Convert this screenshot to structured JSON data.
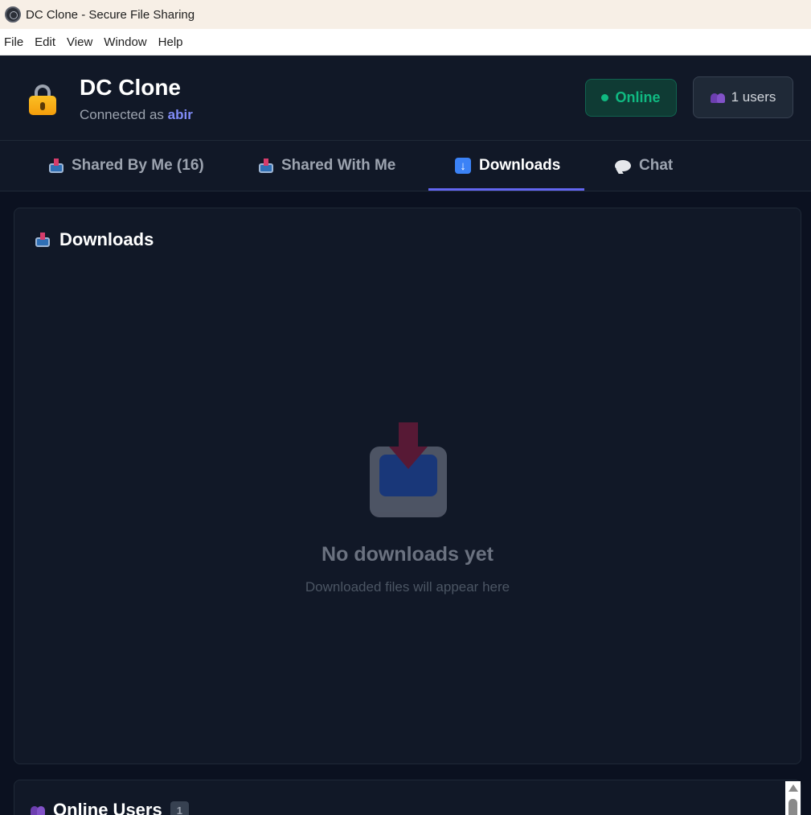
{
  "window": {
    "title": "DC Clone - Secure File Sharing"
  },
  "menu": [
    "File",
    "Edit",
    "View",
    "Window",
    "Help"
  ],
  "header": {
    "app_name": "DC Clone",
    "connected_prefix": "Connected as",
    "username": "abir",
    "status": "Online",
    "users_count": "1 users"
  },
  "tabs": [
    {
      "label": "Shared By Me (16)",
      "icon": "outbox-tray-icon"
    },
    {
      "label": "Shared With Me",
      "icon": "inbox-tray-icon"
    },
    {
      "label": "Downloads",
      "icon": "down-arrow-icon",
      "active": true
    },
    {
      "label": "Chat",
      "icon": "speech-balloon-icon"
    }
  ],
  "downloads": {
    "title": "Downloads",
    "empty_title": "No downloads yet",
    "empty_subtitle": "Downloaded files will appear here"
  },
  "online_users": {
    "title": "Online Users",
    "count": "1"
  },
  "colors": {
    "accent": "#6366f1",
    "online": "#10b981",
    "username": "#818cf8",
    "background": "#0b1120"
  }
}
